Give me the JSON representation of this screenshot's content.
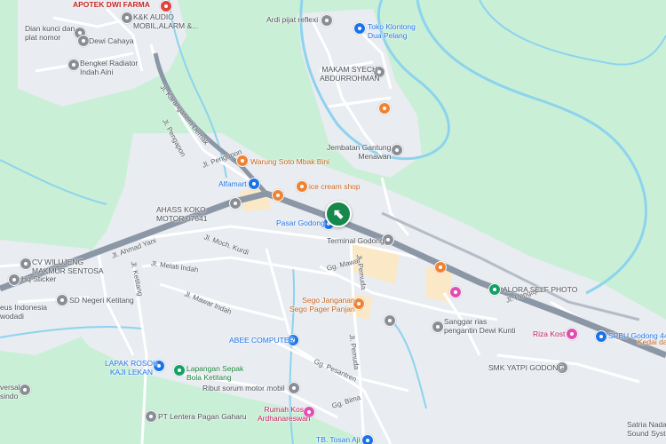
{
  "map": {
    "places": [
      {
        "id": "apotek-dwi-farma",
        "label": "APOTEK DWI FARMA",
        "color": "red"
      },
      {
        "id": "kk-audio",
        "label": "K&K AUDIO\nMOBIL,ALARM &...",
        "color": "grey"
      },
      {
        "id": "dian-kunci",
        "label": "Dian kunci dan\nplat nomor",
        "color": "grey"
      },
      {
        "id": "dewi-cahaya",
        "label": "Dewi Cahaya",
        "color": "grey"
      },
      {
        "id": "bengkel-radiator",
        "label": "Bengkel Radiator\nIndah Aini",
        "color": "grey"
      },
      {
        "id": "ardi-pijat",
        "label": "Ardi pijat reflexi",
        "color": "grey"
      },
      {
        "id": "toko-klontong",
        "label": "Toko Klontong\nDua Pelang",
        "color": "blue"
      },
      {
        "id": "makam-syech",
        "label": "MAKAM SYECH\nABDURROHMAN",
        "color": "grey"
      },
      {
        "id": "jembatan-gantung",
        "label": "Jembatan Gantung\nMenawan",
        "color": "grey"
      },
      {
        "id": "warung-soto",
        "label": "Warung Soto Mbak Bini",
        "color": "orange"
      },
      {
        "id": "alfamart",
        "label": "Alfamart",
        "color": "blue"
      },
      {
        "id": "ice-cream-shop",
        "label": "ice cream shop",
        "color": "orange"
      },
      {
        "id": "ahass-koko",
        "label": "AHASS KOKO\nMOTOR 07641",
        "color": "grey"
      },
      {
        "id": "pasar-godong",
        "label": "Pasar Godong",
        "color": "blue"
      },
      {
        "id": "terminal-godong",
        "label": "Terminal Godong",
        "color": "grey"
      },
      {
        "id": "cv-wilujeng",
        "label": "CV WILUJENG\nMAKMUR SENTOSA",
        "color": "grey"
      },
      {
        "id": "hq-sticker",
        "label": "Hq Sticker",
        "color": "grey"
      },
      {
        "id": "sd-negeri",
        "label": "SD Negeri Ketitang",
        "color": "grey"
      },
      {
        "id": "telkom-indonesia",
        "label": "eus Indonesia\nwodadi",
        "color": "grey"
      },
      {
        "id": "alora-self-photo",
        "label": "ALORA SELF PHOTO",
        "color": "grey"
      },
      {
        "id": "sego-janganan",
        "label": "Sego Janganan\nSego Pager Panjan",
        "color": "orange"
      },
      {
        "id": "sanggar-rias",
        "label": "Sanggar rias\npengantin Dewi Kunti",
        "color": "grey"
      },
      {
        "id": "riza-kost",
        "label": "Riza Kost",
        "color": "pink"
      },
      {
        "id": "spbu-godong",
        "label": "SPBU Godong 44.5",
        "color": "blue"
      },
      {
        "id": "abee-computer",
        "label": "ABEE COMPUTER",
        "color": "blue"
      },
      {
        "id": "lapak-rosok",
        "label": "LAPAK ROSOK\nKAJI LEKAN",
        "color": "blue"
      },
      {
        "id": "lapangan-sepak-bola",
        "label": "Lapangan Sepak\nBola Ketitang",
        "color": "green"
      },
      {
        "id": "smk-yatpi",
        "label": "SMK YATPI GODONG",
        "color": "grey"
      },
      {
        "id": "kedai",
        "label": "Kedai da",
        "color": "orange"
      },
      {
        "id": "ribut-sorum",
        "label": "Ribut sorum motor mobil",
        "color": "grey"
      },
      {
        "id": "rumah-kos",
        "label": "Rumah Kos\nArdhanareswari",
        "color": "pink"
      },
      {
        "id": "universal",
        "label": "versal\nsindo",
        "color": "grey"
      },
      {
        "id": "pt-lentera",
        "label": "PT Lentera Pagan Gaharu",
        "color": "grey"
      },
      {
        "id": "satria-nada",
        "label": "Satria Nada\nSound System",
        "color": "grey"
      },
      {
        "id": "tb-tosan-aji",
        "label": "TB. Tosan Aji",
        "color": "blue"
      }
    ],
    "streets": [
      {
        "id": "jl-ahmad-yani",
        "label": "Jl. Ahmad Yani"
      },
      {
        "id": "jl-pengapon-north",
        "label": "Jl. Pengapon"
      },
      {
        "id": "jl-pengapon-east",
        "label": "Jl. Pengapon"
      },
      {
        "id": "jl-pengapon-mid",
        "label": "Jl. Pengapon"
      },
      {
        "id": "jl-karangasem-demak",
        "label": "Jl. Karangasem Demak"
      },
      {
        "id": "jl-moch-kurdi",
        "label": "Jl. Moch. Kurdi"
      },
      {
        "id": "jl-melati-indah",
        "label": "Jl. Melati Indah"
      },
      {
        "id": "jl-mawar-indah",
        "label": "Jl. Mawar Indah"
      },
      {
        "id": "jl-ketitang",
        "label": "Jl. Ketitang"
      },
      {
        "id": "gg-mawar",
        "label": "Gg. Mawar"
      },
      {
        "id": "jl-pemuda-north",
        "label": "Jl. Pemuda"
      },
      {
        "id": "jl-pemuda-south",
        "label": "Jl. Pemuda"
      },
      {
        "id": "gg-pesantren",
        "label": "Gg. Pesantren"
      },
      {
        "id": "gg-bima",
        "label": "Gg. Bima"
      }
    ],
    "colors": {
      "land": "#c9f0d6",
      "urban": "#e9ecf1",
      "river": "#8ed3ee",
      "highway": "#8c97a6",
      "road": "#ffffff",
      "commercial": "#fbe8c6",
      "current_location": "#17884b"
    }
  }
}
